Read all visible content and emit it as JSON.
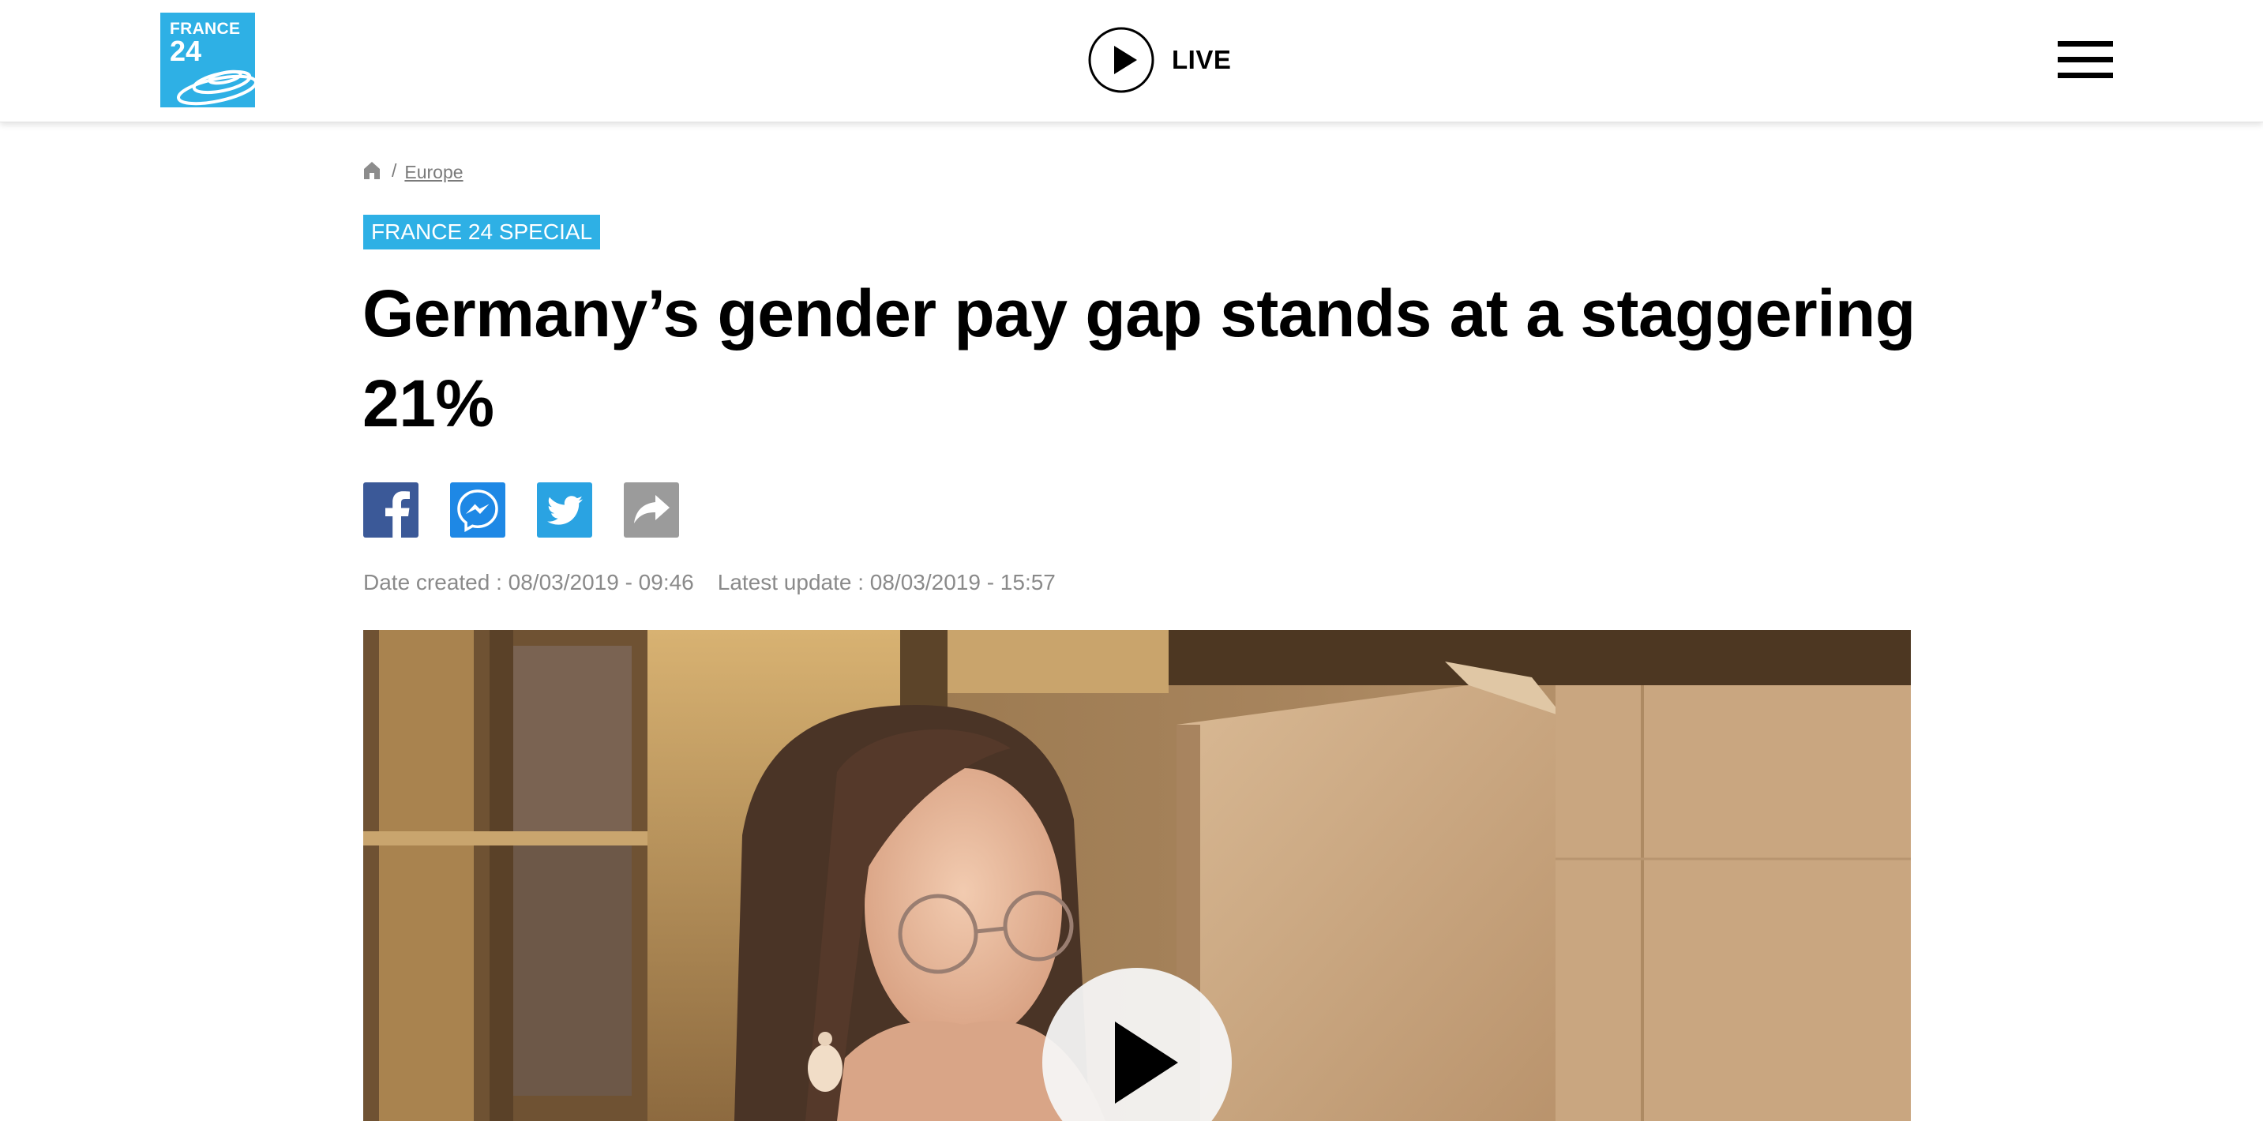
{
  "header": {
    "logo": {
      "line1": "FRANCE",
      "line2": "24",
      "brand_color": "#2eb0e5",
      "icon": "france24-logo"
    },
    "live": {
      "label": "LIVE",
      "icon": "play-circle-icon"
    },
    "menu": {
      "icon": "hamburger-menu-icon"
    }
  },
  "breadcrumb": {
    "home_icon": "home-icon",
    "separator": "/",
    "section": "Europe"
  },
  "article": {
    "tag": "FRANCE 24 SPECIAL",
    "tag_color": "#2eb0e5",
    "title": "Germany’s gender pay gap stands at a staggering 21%",
    "share": [
      {
        "network": "Facebook",
        "icon": "facebook-icon",
        "color": "#3b5998"
      },
      {
        "network": "Messenger",
        "icon": "messenger-icon",
        "color": "#1e88e5"
      },
      {
        "network": "Twitter",
        "icon": "twitter-icon",
        "color": "#2aa3e2"
      },
      {
        "network": "Share",
        "icon": "share-icon",
        "color": "#9b9b9b"
      }
    ],
    "date_created": "Date created : 08/03/2019 - 09:46",
    "latest_update": "Latest update : 08/03/2019 - 15:57"
  },
  "video": {
    "play_icon": "play-icon"
  }
}
